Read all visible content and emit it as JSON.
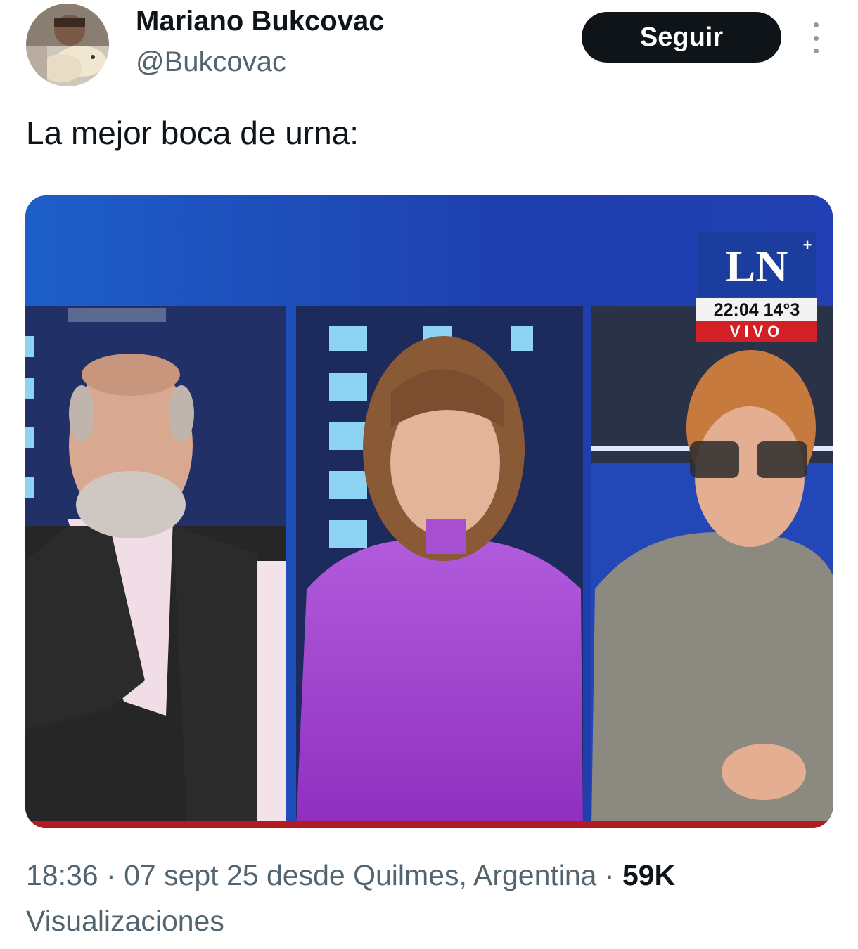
{
  "author": {
    "name": "Mariano Bukcovac",
    "handle": "@Bukcovac",
    "follow_label": "Seguir",
    "more_icon": "more-vertical-icon"
  },
  "tweet": {
    "text": "La mejor boca de urna:"
  },
  "media": {
    "logo_text": "LN",
    "clock": "22:04 14°3",
    "live_label": "VIVO"
  },
  "meta": {
    "time": "18:36",
    "date": "07 sept 25",
    "location": "desde Quilmes, Argentina",
    "separator": "·",
    "views_count": "59K",
    "views_label": "Visualizaciones"
  },
  "colors": {
    "text_primary": "#0f1419",
    "text_secondary": "#536471",
    "button_bg": "#0f1419",
    "button_text": "#ffffff",
    "live_red": "#d41f26",
    "tv_blue": "#1a46b8"
  }
}
